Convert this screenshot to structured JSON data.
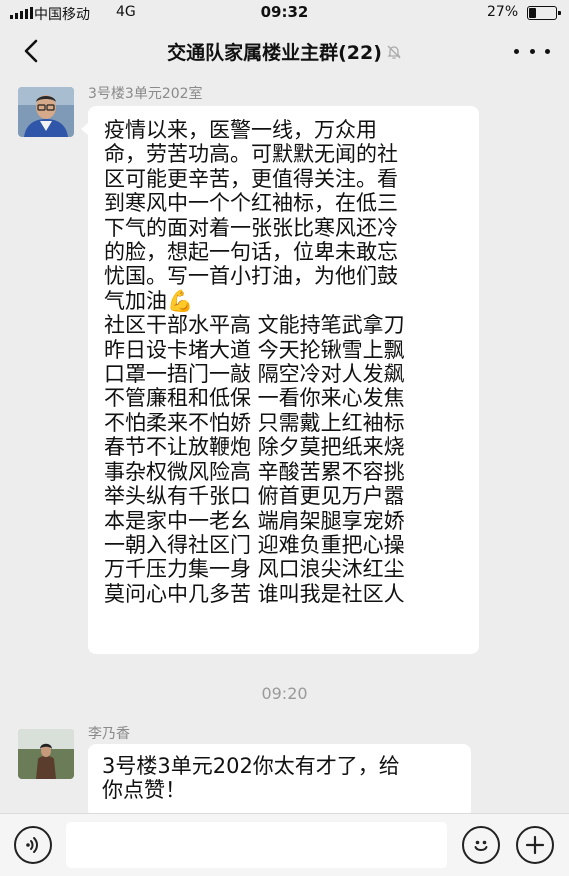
{
  "status_bar": {
    "carrier": "中国移动",
    "network": "4G",
    "time": "09:32",
    "battery_percent": "27%",
    "battery_level": 0.27
  },
  "header": {
    "title": "交通队家属楼业主群(22)",
    "back_icon": "back-arrow-icon",
    "mute_icon": "bell-muted-icon",
    "more_icon": "more-dots-icon"
  },
  "messages": [
    {
      "sender": "3号楼3单元202室",
      "avatar": "avatar-man-with-glasses",
      "paragraph": [
        "疫情以来，医警一线，万众用",
        "命，劳苦功高。可默默无闻的社",
        "区可能更辛苦，更值得关注。看",
        "到寒风中一个个红袖标，在低三",
        "下气的面对着一张张比寒风还冷",
        "的脸，想起一句话，位卑未敢忘",
        "忧国。写一首小打油，为他们鼓",
        "气加油"
      ],
      "emoji": "💪",
      "poem": [
        "社区干部水平高 文能持笔武拿刀",
        "昨日设卡堵大道 今天抡锹雪上飘",
        "口罩一捂门一敲 隔空冷对人发飙",
        "不管廉租和低保 一看你来心发焦",
        "不怕柔来不怕娇 只需戴上红袖标",
        "春节不让放鞭炮 除夕莫把纸来烧",
        "事杂权微风险高 辛酸苦累不容挑",
        "举头纵有千张口 俯首更见万户嚣",
        "本是家中一老幺 端肩架腿享宠娇",
        "一朝入得社区门 迎难负重把心操",
        "万千压力集一身 风口浪尖沐红尘",
        "莫问心中几多苦 谁叫我是社区人"
      ]
    },
    {
      "sender": "李乃香",
      "avatar": "avatar-woman-outdoor",
      "lines": [
        "3号楼3单元202你太有才了，给",
        "你点赞！"
      ]
    }
  ],
  "timestamp": "09:20",
  "input_bar": {
    "voice_icon": "voice-icon",
    "emoji_icon": "emoji-smile-icon",
    "plus_icon": "plus-icon",
    "text_value": ""
  }
}
